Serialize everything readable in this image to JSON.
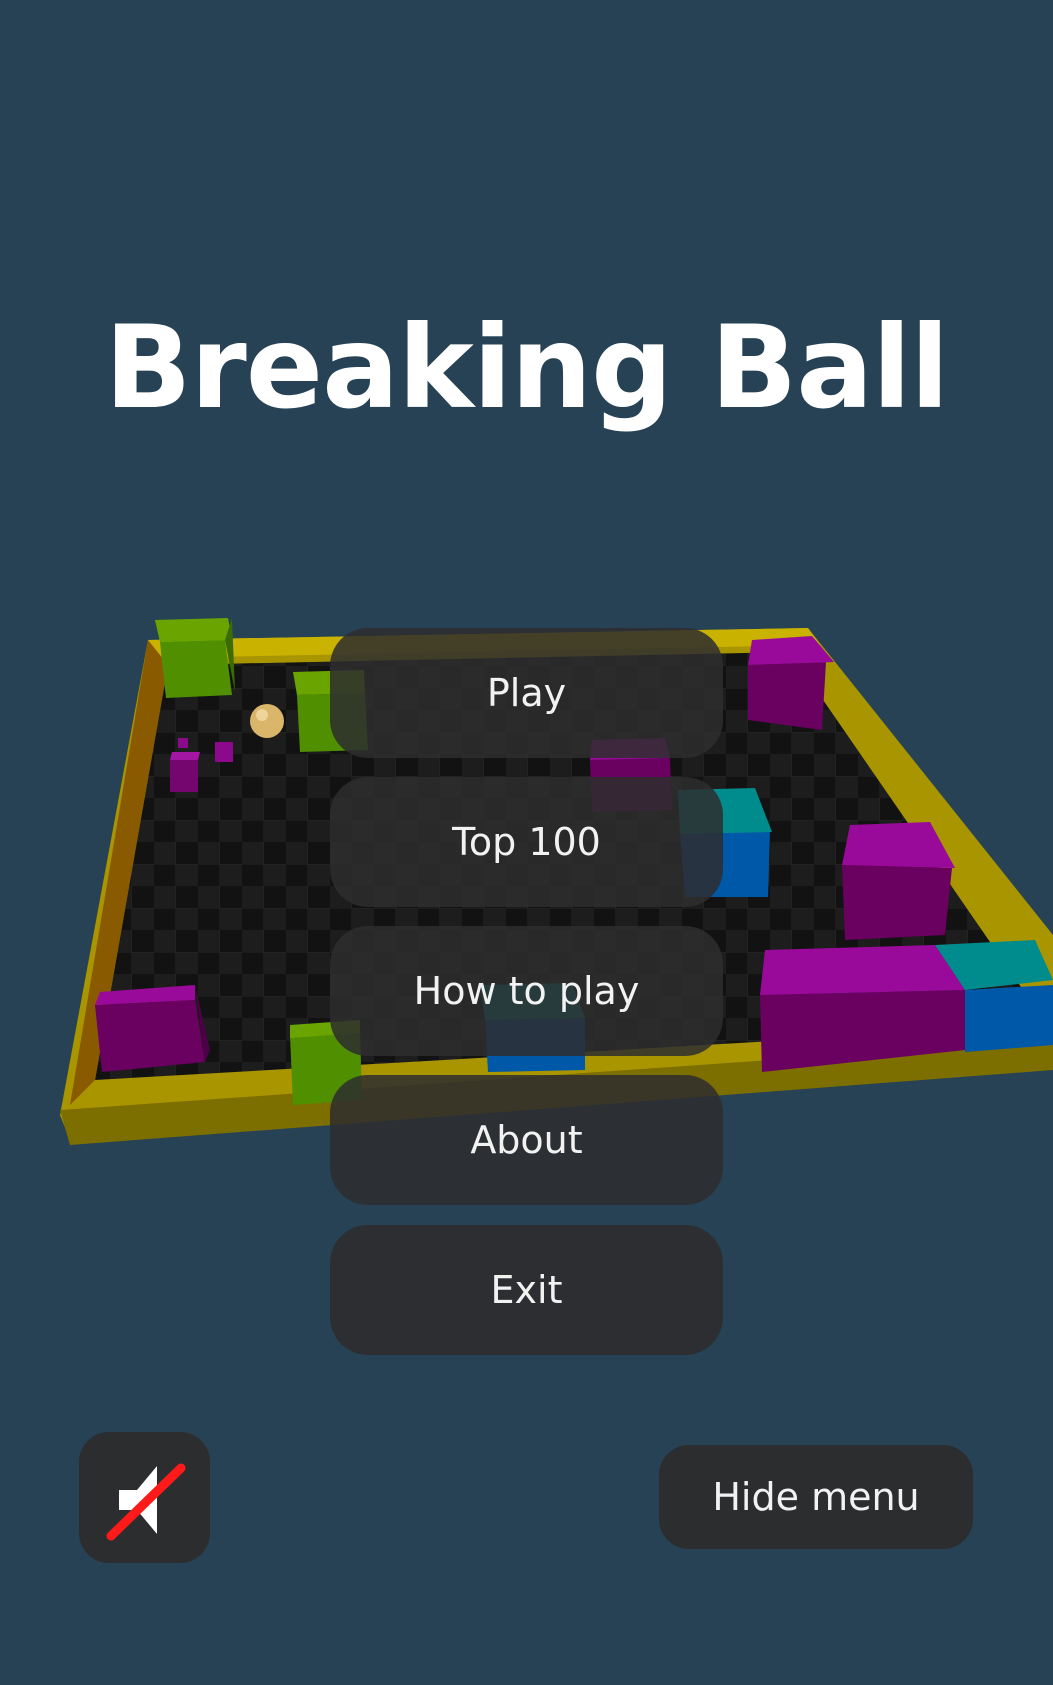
{
  "title": "Breaking Ball",
  "menu": {
    "play": "Play",
    "top100": "Top 100",
    "how_to_play": "How to play",
    "about": "About",
    "exit": "Exit"
  },
  "controls": {
    "hide_menu": "Hide menu",
    "sound_icon": "speaker-muted-icon"
  },
  "colors": {
    "background": "#264254",
    "board_frame": "#b8a300",
    "board_floor": "#141414",
    "block_magenta": "#8b0a8b",
    "block_green": "#5a9c00",
    "block_teal": "#008080",
    "block_blue": "#0058a8",
    "button_bg": "#2c2d2f",
    "mute_slash": "#ff1a1a"
  }
}
